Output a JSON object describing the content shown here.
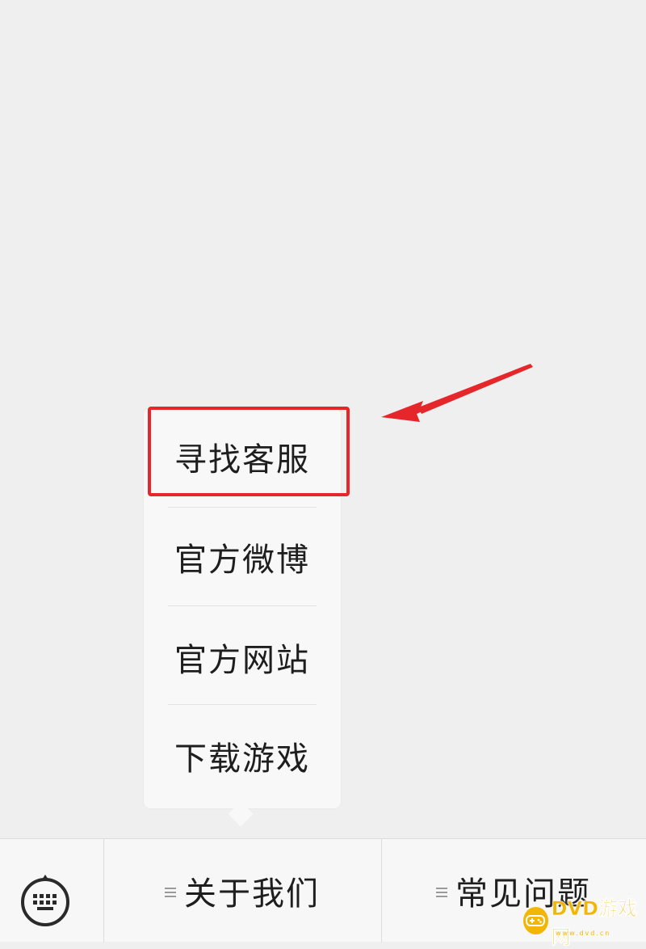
{
  "submenu": {
    "items": [
      {
        "label": "寻找客服",
        "highlighted": true
      },
      {
        "label": "官方微博",
        "highlighted": false
      },
      {
        "label": "官方网站",
        "highlighted": false
      },
      {
        "label": "下载游戏",
        "highlighted": false
      }
    ]
  },
  "menu_bar": {
    "keyboard_icon": "keyboard-icon",
    "buttons": [
      {
        "label": "关于我们",
        "icon": "menu-lines-icon",
        "highlighted": true
      },
      {
        "label": "常见问题",
        "icon": "menu-lines-icon",
        "highlighted": false
      }
    ]
  },
  "annotation": {
    "color": "#e5262a",
    "arrow_icon": "red-arrow-icon"
  },
  "watermark": {
    "text": "DVD游戏网",
    "sub": "www.dvd.cn"
  },
  "colors": {
    "background": "#efefef",
    "menu_bar": "#f7f7f7",
    "popup": "#f8f8f8",
    "highlight": "#e5262a",
    "watermark": "#f2b705"
  }
}
